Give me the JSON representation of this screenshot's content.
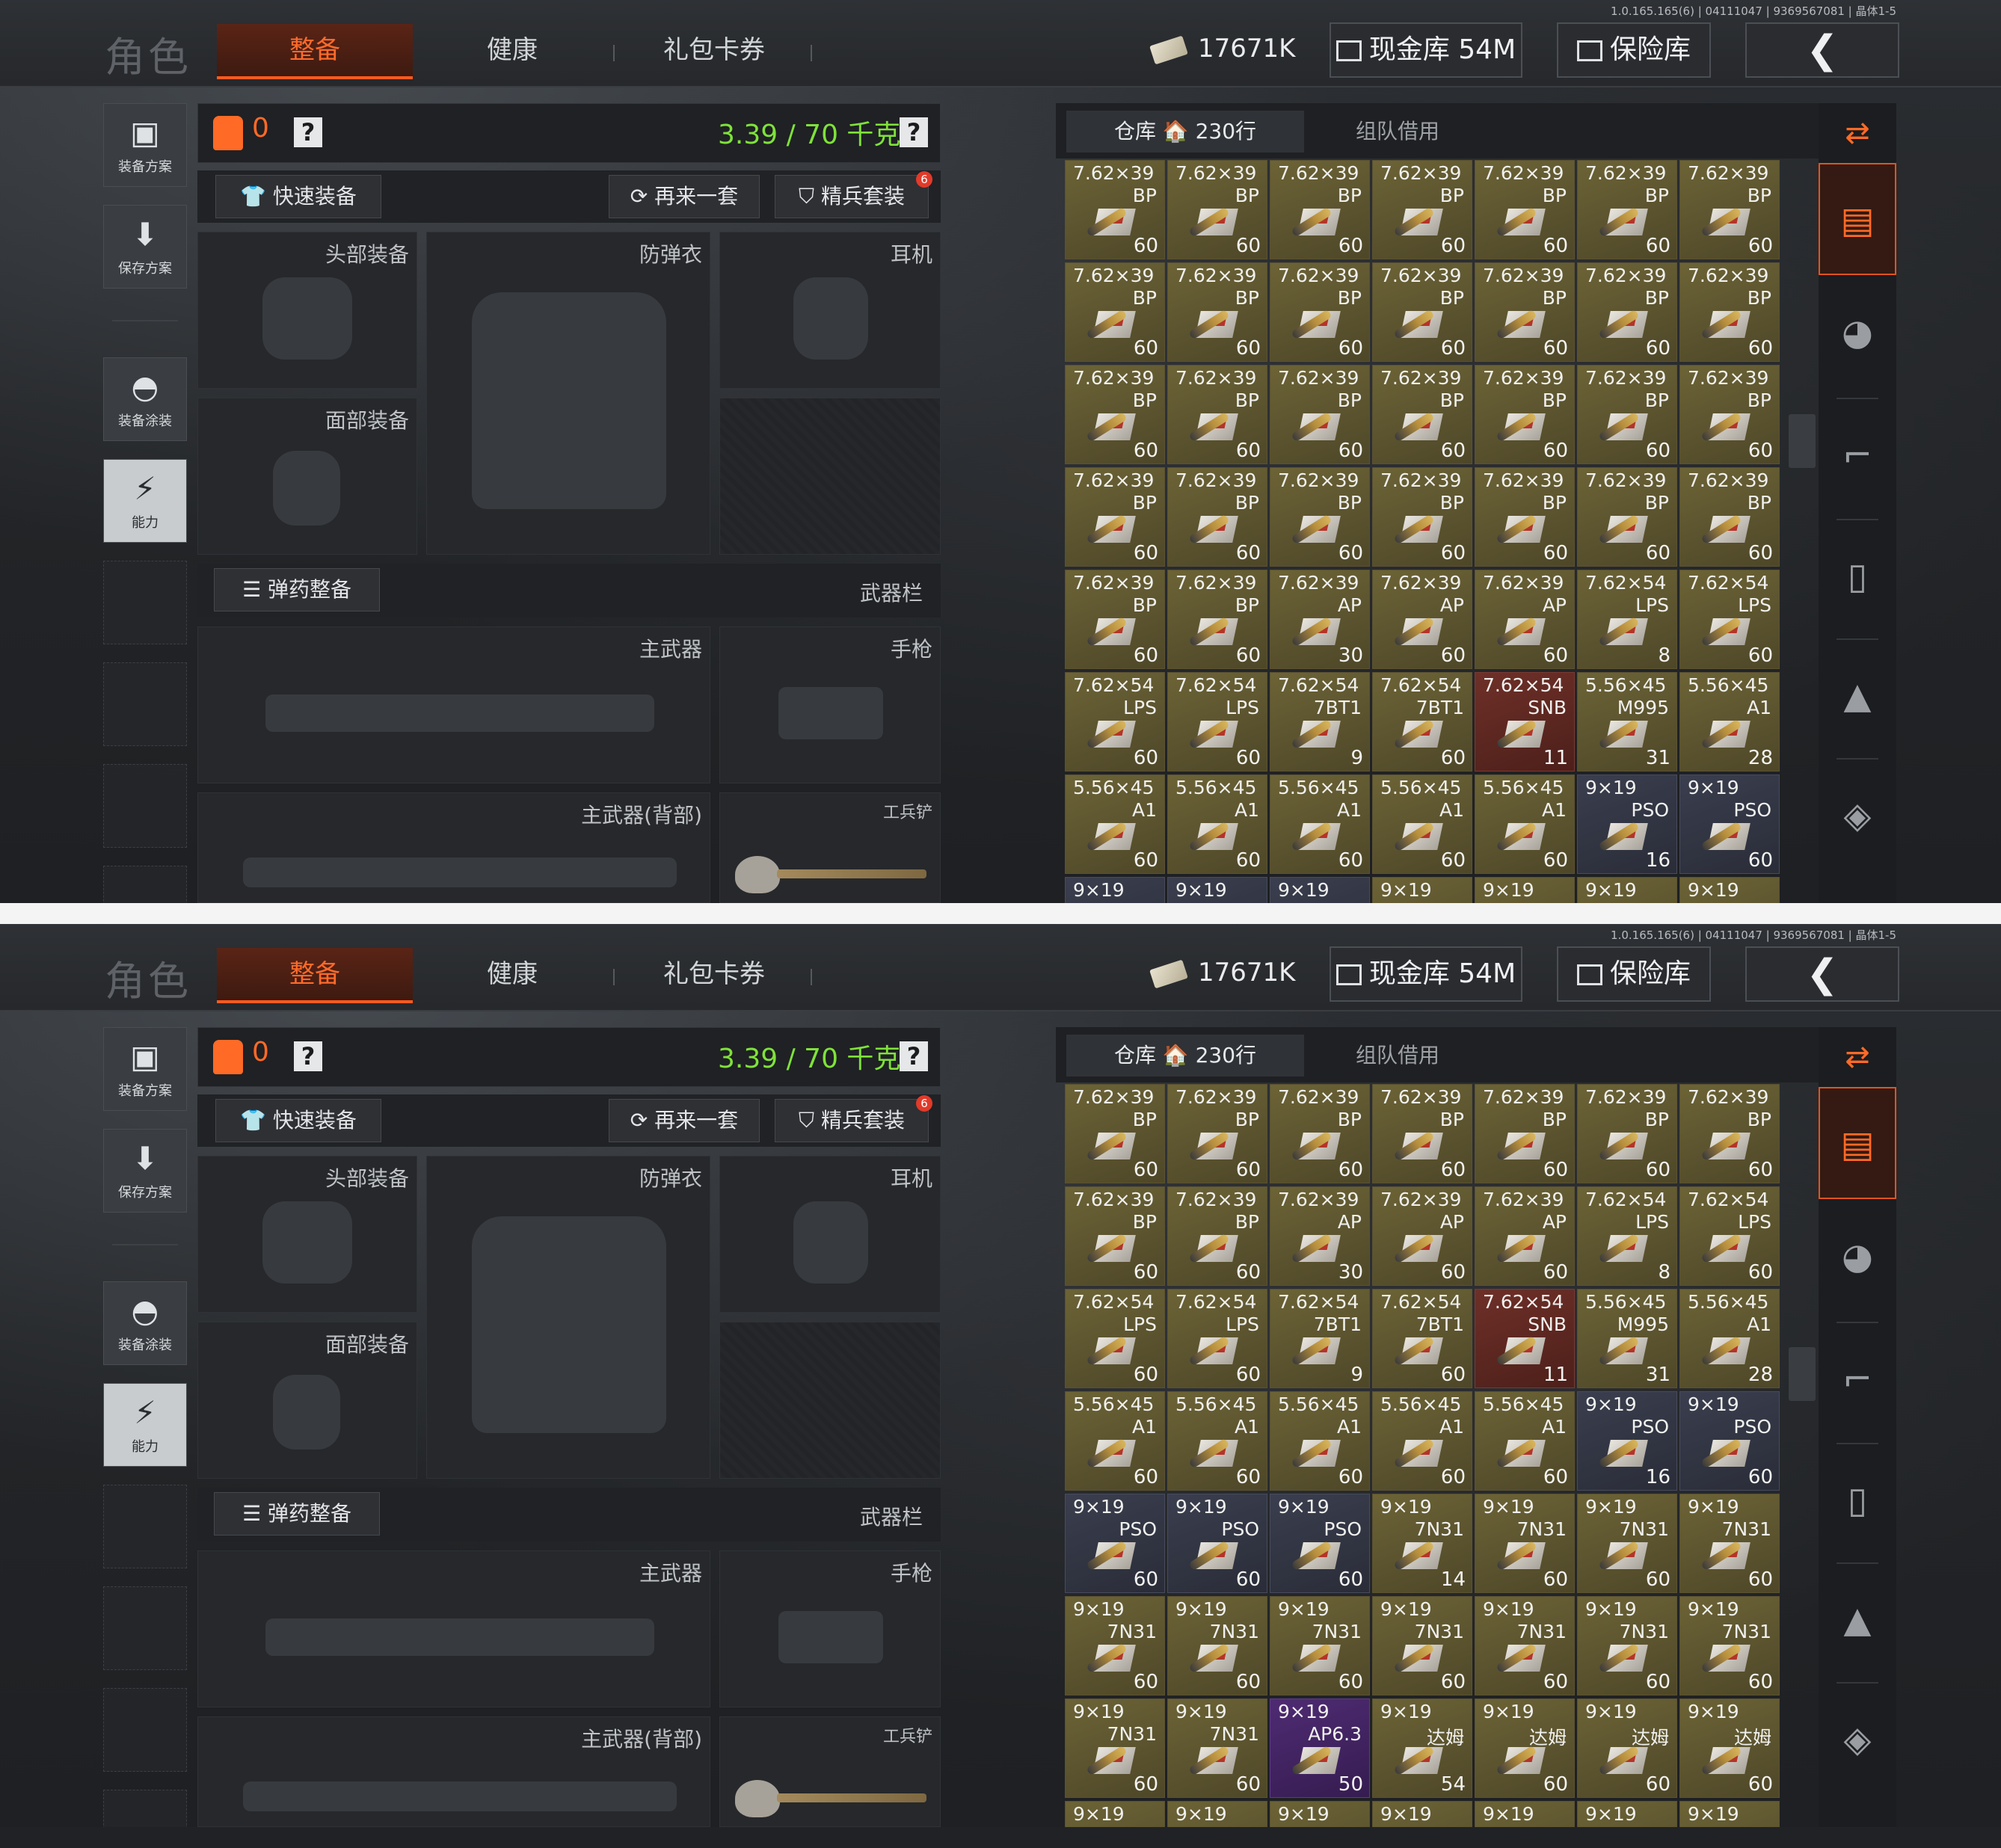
{
  "version": "1.0.165.165(6) | 04111047 | 9369567081 | 晶体1-5",
  "nav": {
    "title": "角色",
    "tab_active": "整备",
    "tab_health": "健康",
    "tab_gift": "礼包卡券"
  },
  "currency": {
    "money": "17671K",
    "cash_vault": "现金库 54M",
    "safe": "保险库",
    "back_glyph": "❮"
  },
  "sidebar": {
    "loadout": "装备方案",
    "save": "保存方案",
    "skin": "装备涂装",
    "ability": "能力"
  },
  "equip": {
    "bag_count": "0",
    "help": "?",
    "weight": "3.39 / 70 千克",
    "quick_equip": "快速装备",
    "again": "再来一套",
    "elite": "精兵套装",
    "elite_badge": "6",
    "head": "头部装备",
    "vest": "防弹衣",
    "ear": "耳机",
    "face": "面部装备",
    "ammo_sort": "弹药整备",
    "weapon_bar": "武器栏",
    "primary": "主武器",
    "pistol": "手枪",
    "primary_back": "主武器(背部)",
    "shovel": "工兵铲"
  },
  "warehouse": {
    "tab_storage": "仓库 🏠 230行",
    "tab_team": "组队借用"
  },
  "colors": {
    "accent": "#ff6a26",
    "weight_green": "#7fe23a",
    "cell_gold": "#6c6336",
    "cell_red": "#6e3028",
    "cell_blue": "#3a3e4e",
    "cell_purple": "#4f2b73"
  },
  "icons": [
    "vest-icon",
    "download-icon",
    "helmet-icon",
    "ability-icon",
    "ammo-stack-icon",
    "grenade-icon",
    "weapon-icon",
    "magazine-icon",
    "bullet-icon",
    "scope-icon"
  ],
  "grid_top": [
    {
      "c": "7.62×39",
      "t": "BP",
      "q": "60",
      "s": "gold"
    },
    {
      "c": "7.62×39",
      "t": "BP",
      "q": "60",
      "s": "gold"
    },
    {
      "c": "7.62×39",
      "t": "BP",
      "q": "60",
      "s": "gold"
    },
    {
      "c": "7.62×39",
      "t": "BP",
      "q": "60",
      "s": "gold"
    },
    {
      "c": "7.62×39",
      "t": "BP",
      "q": "60",
      "s": "gold"
    },
    {
      "c": "7.62×39",
      "t": "BP",
      "q": "60",
      "s": "gold"
    },
    {
      "c": "7.62×39",
      "t": "BP",
      "q": "60",
      "s": "gold"
    },
    {
      "c": "7.62×39",
      "t": "BP",
      "q": "60",
      "s": "gold"
    },
    {
      "c": "7.62×39",
      "t": "BP",
      "q": "60",
      "s": "gold"
    },
    {
      "c": "7.62×39",
      "t": "BP",
      "q": "60",
      "s": "gold"
    },
    {
      "c": "7.62×39",
      "t": "BP",
      "q": "60",
      "s": "gold"
    },
    {
      "c": "7.62×39",
      "t": "BP",
      "q": "60",
      "s": "gold"
    },
    {
      "c": "7.62×39",
      "t": "BP",
      "q": "60",
      "s": "gold"
    },
    {
      "c": "7.62×39",
      "t": "BP",
      "q": "60",
      "s": "gold"
    },
    {
      "c": "7.62×39",
      "t": "BP",
      "q": "60",
      "s": "gold"
    },
    {
      "c": "7.62×39",
      "t": "BP",
      "q": "60",
      "s": "gold"
    },
    {
      "c": "7.62×39",
      "t": "BP",
      "q": "60",
      "s": "gold"
    },
    {
      "c": "7.62×39",
      "t": "BP",
      "q": "60",
      "s": "gold"
    },
    {
      "c": "7.62×39",
      "t": "BP",
      "q": "60",
      "s": "gold"
    },
    {
      "c": "7.62×39",
      "t": "BP",
      "q": "60",
      "s": "gold"
    },
    {
      "c": "7.62×39",
      "t": "BP",
      "q": "60",
      "s": "gold"
    },
    {
      "c": "7.62×39",
      "t": "BP",
      "q": "60",
      "s": "gold"
    },
    {
      "c": "7.62×39",
      "t": "BP",
      "q": "60",
      "s": "gold"
    },
    {
      "c": "7.62×39",
      "t": "BP",
      "q": "60",
      "s": "gold"
    },
    {
      "c": "7.62×39",
      "t": "BP",
      "q": "60",
      "s": "gold"
    },
    {
      "c": "7.62×39",
      "t": "BP",
      "q": "60",
      "s": "gold"
    },
    {
      "c": "7.62×39",
      "t": "BP",
      "q": "60",
      "s": "gold"
    },
    {
      "c": "7.62×39",
      "t": "BP",
      "q": "60",
      "s": "gold"
    },
    {
      "c": "7.62×39",
      "t": "BP",
      "q": "60",
      "s": "gold"
    },
    {
      "c": "7.62×39",
      "t": "BP",
      "q": "60",
      "s": "gold"
    },
    {
      "c": "7.62×39",
      "t": "AP",
      "q": "30",
      "s": "gold"
    },
    {
      "c": "7.62×39",
      "t": "AP",
      "q": "60",
      "s": "gold"
    },
    {
      "c": "7.62×39",
      "t": "AP",
      "q": "60",
      "s": "gold"
    },
    {
      "c": "7.62×54",
      "t": "LPS",
      "q": "8",
      "s": "gold"
    },
    {
      "c": "7.62×54",
      "t": "LPS",
      "q": "60",
      "s": "gold"
    },
    {
      "c": "7.62×54",
      "t": "LPS",
      "q": "60",
      "s": "gold"
    },
    {
      "c": "7.62×54",
      "t": "LPS",
      "q": "60",
      "s": "gold"
    },
    {
      "c": "7.62×54",
      "t": "7BT1",
      "q": "9",
      "s": "gold"
    },
    {
      "c": "7.62×54",
      "t": "7BT1",
      "q": "60",
      "s": "gold"
    },
    {
      "c": "7.62×54",
      "t": "SNB",
      "q": "11",
      "s": "red"
    },
    {
      "c": "5.56×45",
      "t": "M995",
      "q": "31",
      "s": "gold"
    },
    {
      "c": "5.56×45",
      "t": "A1",
      "q": "28",
      "s": "gold"
    },
    {
      "c": "5.56×45",
      "t": "A1",
      "q": "60",
      "s": "gold"
    },
    {
      "c": "5.56×45",
      "t": "A1",
      "q": "60",
      "s": "gold"
    },
    {
      "c": "5.56×45",
      "t": "A1",
      "q": "60",
      "s": "gold"
    },
    {
      "c": "5.56×45",
      "t": "A1",
      "q": "60",
      "s": "gold"
    },
    {
      "c": "5.56×45",
      "t": "A1",
      "q": "60",
      "s": "gold"
    },
    {
      "c": "9×19",
      "t": "PSO",
      "q": "16",
      "s": "blue"
    },
    {
      "c": "9×19",
      "t": "PSO",
      "q": "60",
      "s": "blue"
    },
    {
      "c": "9×19",
      "t": "",
      "q": "",
      "s": "blue"
    },
    {
      "c": "9×19",
      "t": "",
      "q": "",
      "s": "blue"
    },
    {
      "c": "9×19",
      "t": "",
      "q": "",
      "s": "blue"
    },
    {
      "c": "9×19",
      "t": "",
      "q": "",
      "s": "gold"
    },
    {
      "c": "9×19",
      "t": "",
      "q": "",
      "s": "gold"
    },
    {
      "c": "9×19",
      "t": "",
      "q": "",
      "s": "gold"
    },
    {
      "c": "9×19",
      "t": "",
      "q": "",
      "s": "gold"
    }
  ],
  "grid_bottom": [
    {
      "c": "7.62×39",
      "t": "BP",
      "q": "60",
      "s": "gold"
    },
    {
      "c": "7.62×39",
      "t": "BP",
      "q": "60",
      "s": "gold"
    },
    {
      "c": "7.62×39",
      "t": "BP",
      "q": "60",
      "s": "gold"
    },
    {
      "c": "7.62×39",
      "t": "BP",
      "q": "60",
      "s": "gold"
    },
    {
      "c": "7.62×39",
      "t": "BP",
      "q": "60",
      "s": "gold"
    },
    {
      "c": "7.62×39",
      "t": "BP",
      "q": "60",
      "s": "gold"
    },
    {
      "c": "7.62×39",
      "t": "BP",
      "q": "60",
      "s": "gold"
    },
    {
      "c": "7.62×39",
      "t": "BP",
      "q": "60",
      "s": "gold"
    },
    {
      "c": "7.62×39",
      "t": "BP",
      "q": "60",
      "s": "gold"
    },
    {
      "c": "7.62×39",
      "t": "AP",
      "q": "30",
      "s": "gold"
    },
    {
      "c": "7.62×39",
      "t": "AP",
      "q": "60",
      "s": "gold"
    },
    {
      "c": "7.62×39",
      "t": "AP",
      "q": "60",
      "s": "gold"
    },
    {
      "c": "7.62×54",
      "t": "LPS",
      "q": "8",
      "s": "gold"
    },
    {
      "c": "7.62×54",
      "t": "LPS",
      "q": "60",
      "s": "gold"
    },
    {
      "c": "7.62×54",
      "t": "LPS",
      "q": "60",
      "s": "gold"
    },
    {
      "c": "7.62×54",
      "t": "LPS",
      "q": "60",
      "s": "gold"
    },
    {
      "c": "7.62×54",
      "t": "7BT1",
      "q": "9",
      "s": "gold"
    },
    {
      "c": "7.62×54",
      "t": "7BT1",
      "q": "60",
      "s": "gold"
    },
    {
      "c": "7.62×54",
      "t": "SNB",
      "q": "11",
      "s": "red"
    },
    {
      "c": "5.56×45",
      "t": "M995",
      "q": "31",
      "s": "gold"
    },
    {
      "c": "5.56×45",
      "t": "A1",
      "q": "28",
      "s": "gold"
    },
    {
      "c": "5.56×45",
      "t": "A1",
      "q": "60",
      "s": "gold"
    },
    {
      "c": "5.56×45",
      "t": "A1",
      "q": "60",
      "s": "gold"
    },
    {
      "c": "5.56×45",
      "t": "A1",
      "q": "60",
      "s": "gold"
    },
    {
      "c": "5.56×45",
      "t": "A1",
      "q": "60",
      "s": "gold"
    },
    {
      "c": "5.56×45",
      "t": "A1",
      "q": "60",
      "s": "gold"
    },
    {
      "c": "9×19",
      "t": "PSO",
      "q": "16",
      "s": "blue"
    },
    {
      "c": "9×19",
      "t": "PSO",
      "q": "60",
      "s": "blue"
    },
    {
      "c": "9×19",
      "t": "PSO",
      "q": "60",
      "s": "blue"
    },
    {
      "c": "9×19",
      "t": "PSO",
      "q": "60",
      "s": "blue"
    },
    {
      "c": "9×19",
      "t": "PSO",
      "q": "60",
      "s": "blue"
    },
    {
      "c": "9×19",
      "t": "7N31",
      "q": "14",
      "s": "gold"
    },
    {
      "c": "9×19",
      "t": "7N31",
      "q": "60",
      "s": "gold"
    },
    {
      "c": "9×19",
      "t": "7N31",
      "q": "60",
      "s": "gold"
    },
    {
      "c": "9×19",
      "t": "7N31",
      "q": "60",
      "s": "gold"
    },
    {
      "c": "9×19",
      "t": "7N31",
      "q": "60",
      "s": "gold"
    },
    {
      "c": "9×19",
      "t": "7N31",
      "q": "60",
      "s": "gold"
    },
    {
      "c": "9×19",
      "t": "7N31",
      "q": "60",
      "s": "gold"
    },
    {
      "c": "9×19",
      "t": "7N31",
      "q": "60",
      "s": "gold"
    },
    {
      "c": "9×19",
      "t": "7N31",
      "q": "60",
      "s": "gold"
    },
    {
      "c": "9×19",
      "t": "7N31",
      "q": "60",
      "s": "gold"
    },
    {
      "c": "9×19",
      "t": "7N31",
      "q": "60",
      "s": "gold"
    },
    {
      "c": "9×19",
      "t": "7N31",
      "q": "60",
      "s": "gold"
    },
    {
      "c": "9×19",
      "t": "7N31",
      "q": "60",
      "s": "gold"
    },
    {
      "c": "9×19",
      "t": "AP6.3",
      "q": "50",
      "s": "purple"
    },
    {
      "c": "9×19",
      "t": "达姆",
      "q": "54",
      "s": "gold"
    },
    {
      "c": "9×19",
      "t": "达姆",
      "q": "60",
      "s": "gold"
    },
    {
      "c": "9×19",
      "t": "达姆",
      "q": "60",
      "s": "gold"
    },
    {
      "c": "9×19",
      "t": "达姆",
      "q": "60",
      "s": "gold"
    },
    {
      "c": "9×19",
      "t": "",
      "q": "",
      "s": "gold"
    },
    {
      "c": "9×19",
      "t": "",
      "q": "",
      "s": "gold"
    },
    {
      "c": "9×19",
      "t": "",
      "q": "",
      "s": "gold"
    },
    {
      "c": "9×19",
      "t": "",
      "q": "",
      "s": "gold"
    },
    {
      "c": "9×19",
      "t": "",
      "q": "",
      "s": "gold"
    },
    {
      "c": "9×19",
      "t": "",
      "q": "",
      "s": "gold"
    },
    {
      "c": "9×19",
      "t": "",
      "q": "",
      "s": "gold"
    }
  ]
}
